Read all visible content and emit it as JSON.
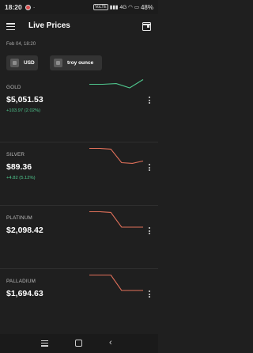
{
  "status_bar": {
    "time": "18:20",
    "network": "VoLTE",
    "signal": "4G",
    "battery": "48%"
  },
  "app_bar": {
    "title": "Live Prices",
    "menu_icon": "hamburger-menu-icon",
    "right_icon": "calendar-icon"
  },
  "date": "Feb 04, 18:20",
  "chips": {
    "currency": "USD",
    "unit": "troy ounce"
  },
  "colors": {
    "background": "#1f1f1f",
    "up": "#4fc78e",
    "down": "#e0705a"
  },
  "metals": [
    {
      "name": "GOLD",
      "price": "$5,051.53",
      "change": "+103.97 (2.02%)",
      "trend": "up",
      "sparkline": [
        0.75,
        0.75,
        0.78,
        0.6,
        0.95
      ]
    },
    {
      "name": "SILVER",
      "price": "$89.36",
      "change": "+4.82 (5.12%)",
      "trend": "down",
      "sparkline": [
        0.95,
        0.95,
        0.92,
        0.35,
        0.32,
        0.42
      ]
    },
    {
      "name": "PLATINUM",
      "price": "$2,098.42",
      "change": "",
      "trend": "down",
      "sparkline": [
        0.95,
        0.95,
        0.92,
        0.3,
        0.3,
        0.3
      ]
    },
    {
      "name": "PALLADIUM",
      "price": "$1,694.63",
      "change": "",
      "trend": "down",
      "sparkline": [
        0.95,
        0.95,
        0.95,
        0.3,
        0.3,
        0.3
      ]
    }
  ]
}
